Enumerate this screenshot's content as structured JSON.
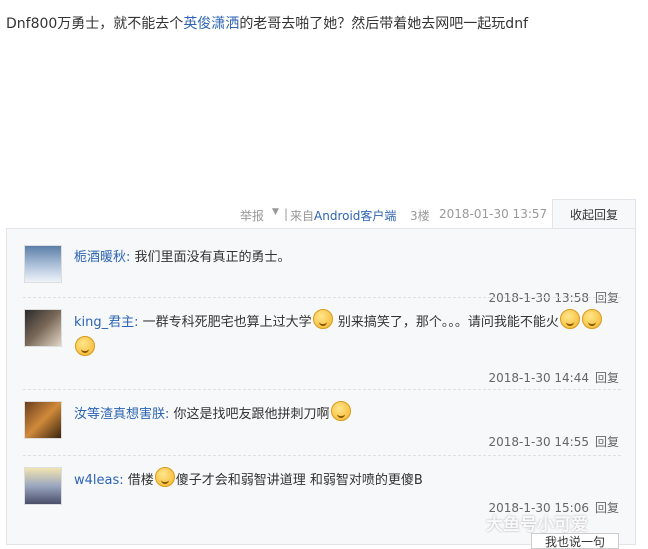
{
  "post": {
    "text_before": "Dnf800万勇士，就不能去个",
    "link": "英俊潇洒",
    "text_after": "的老哥去啪了她？然后带着她去网吧一起玩dnf"
  },
  "meta": {
    "report": "举报",
    "from_prefix": "来自",
    "client": "Android客户端",
    "floor": "3楼",
    "time": "2018-01-30 13:57",
    "collapse_reply": "收起回复"
  },
  "comments": [
    {
      "name": "栀酒暖秋:",
      "text": "我们里面没有真正的勇士。",
      "time": "2018-1-30 13:58",
      "reply": "回复"
    },
    {
      "name": "king_君主:",
      "text_1": "一群专科死肥宅也算上过大学",
      "text_2": "别来搞笑了，那个。。。请问我能不能火",
      "time": "2018-1-30 14:44",
      "reply": "回复"
    },
    {
      "name": "汝等渣真想害朕:",
      "text": "你这是找吧友跟他拼刺刀啊",
      "time": "2018-1-30 14:55",
      "reply": "回复"
    },
    {
      "name": "w4leas:",
      "text_1": "借楼",
      "text_2": "傻子才会和弱智讲道理 和弱智对喷的更傻B",
      "time": "2018-1-30 15:06",
      "reply": "回复"
    }
  ],
  "say_one": "我也说一句",
  "watermark": "大鱼号小可爱",
  "icons": {
    "emoji": "smiley-emoji-icon",
    "caret": "caret-down-icon"
  }
}
